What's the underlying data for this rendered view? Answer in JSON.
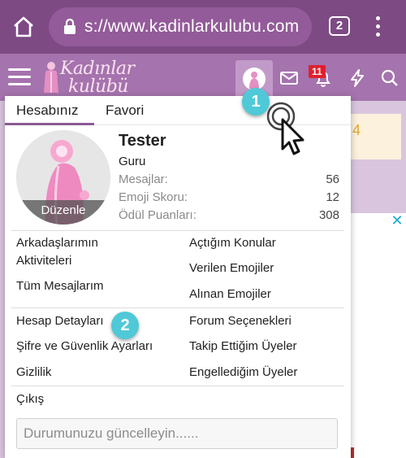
{
  "browser": {
    "url": "s://www.kadinlarkulubu.com",
    "tab_count": "2"
  },
  "site": {
    "logo_line1": "Kadınlar",
    "logo_line2": "kulübü",
    "alert_count": "11"
  },
  "menu": {
    "tabs": [
      {
        "label": "Hesabınız",
        "active": true
      },
      {
        "label": "Favori",
        "active": false
      }
    ],
    "profile": {
      "edit_label": "Düzenle",
      "name": "Tester",
      "title": "Guru",
      "stats": [
        {
          "label": "Mesajlar:",
          "value": "56"
        },
        {
          "label": "Emoji Skoru:",
          "value": "12"
        },
        {
          "label": "Ödül Puanları:",
          "value": "308"
        }
      ]
    },
    "links_left_group1": [
      "Arkadaşlarımın Aktiviteleri",
      "Tüm Mesajlarım"
    ],
    "links_right_group1": [
      "Açtığım Konular",
      "Verilen Emojiler",
      "Alınan Emojiler"
    ],
    "links_left_group2": [
      "Hesap Detayları",
      "Şifre ve Güvenlik Ayarları",
      "Gizlilik"
    ],
    "links_right_group2": [
      "Forum Seçenekleri",
      "Takip Ettiğim Üyeler",
      "Engellediğim Üyeler"
    ],
    "logout_label": "Çıkış",
    "status_placeholder": "Durumunuzu güncelleyin......"
  },
  "annotations": {
    "step1": "1",
    "step2": "2"
  },
  "colors": {
    "browser_bar": "#7d4a84",
    "site_header": "#a573ad",
    "accent": "#8a5a93",
    "step_badge": "#4fc9d7",
    "alert_badge": "#e0202d"
  },
  "background": {
    "panel_text": "4"
  }
}
